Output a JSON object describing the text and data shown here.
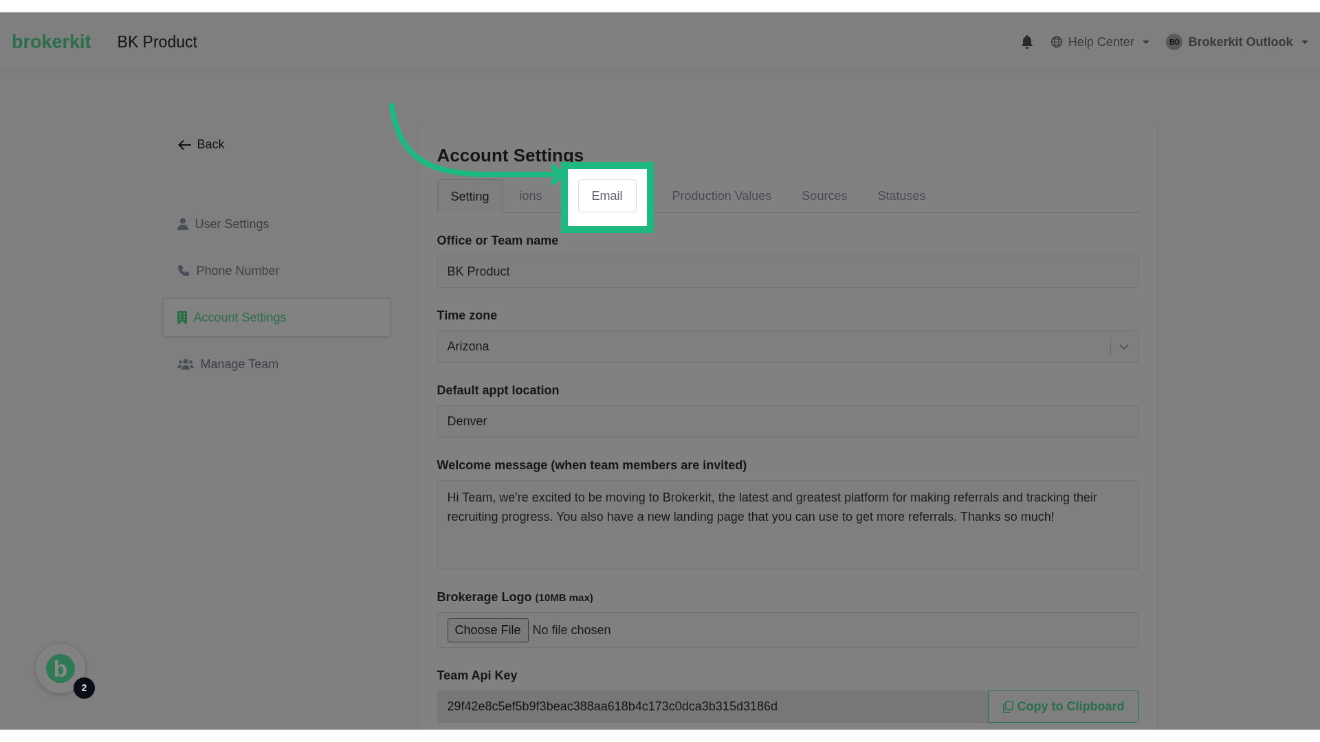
{
  "header": {
    "brand": "brokerkit",
    "workspace": "BK Product",
    "help": "Help Center",
    "user_initials": "BO",
    "user_name": "Brokerkit Outlook"
  },
  "sidebar": {
    "back": "Back",
    "items": [
      {
        "label": "User Settings",
        "selected": false
      },
      {
        "label": "Phone Number",
        "selected": false
      },
      {
        "label": "Account Settings",
        "selected": true
      },
      {
        "label": "Manage Team",
        "selected": false
      }
    ]
  },
  "card": {
    "title": "Account Settings",
    "tabs": [
      {
        "label": "Setting",
        "selected": true,
        "highlighted": false
      },
      {
        "label": "ions",
        "selected": false,
        "highlighted": false
      },
      {
        "label": "Email",
        "selected": false,
        "highlighted": true
      },
      {
        "label": "Production Values",
        "selected": false,
        "highlighted": false
      },
      {
        "label": "Sources",
        "selected": false,
        "highlighted": false
      },
      {
        "label": "Statuses",
        "selected": false,
        "highlighted": false
      }
    ],
    "fields": [
      {
        "kind": "text",
        "label": "Office or Team name",
        "value": "BK Product"
      },
      {
        "kind": "select",
        "label": "Time zone",
        "value": "Arizona"
      },
      {
        "kind": "text",
        "label": "Default appt location",
        "value": "Denver"
      },
      {
        "kind": "textarea",
        "label": "Welcome message (when team members are invited)",
        "value": "Hi Team, we're excited to be moving to Brokerkit, the latest and greatest platform for making referrals and tracking their recruiting progress. You also have a new landing page that you can use to get more referrals. Thanks so much!"
      },
      {
        "kind": "file",
        "label": "Brokerage Logo",
        "hint": "(10MB max)",
        "button": "Choose File",
        "status": "No file chosen"
      },
      {
        "kind": "copy",
        "label": "Team Api Key",
        "value": "29f42e8c5ef5b9f3beac388aa618b4c173c0dca3b315d3186d",
        "button": "Copy to Clipboard"
      }
    ]
  },
  "chat": {
    "logo_letter": "b",
    "badge": "2"
  }
}
